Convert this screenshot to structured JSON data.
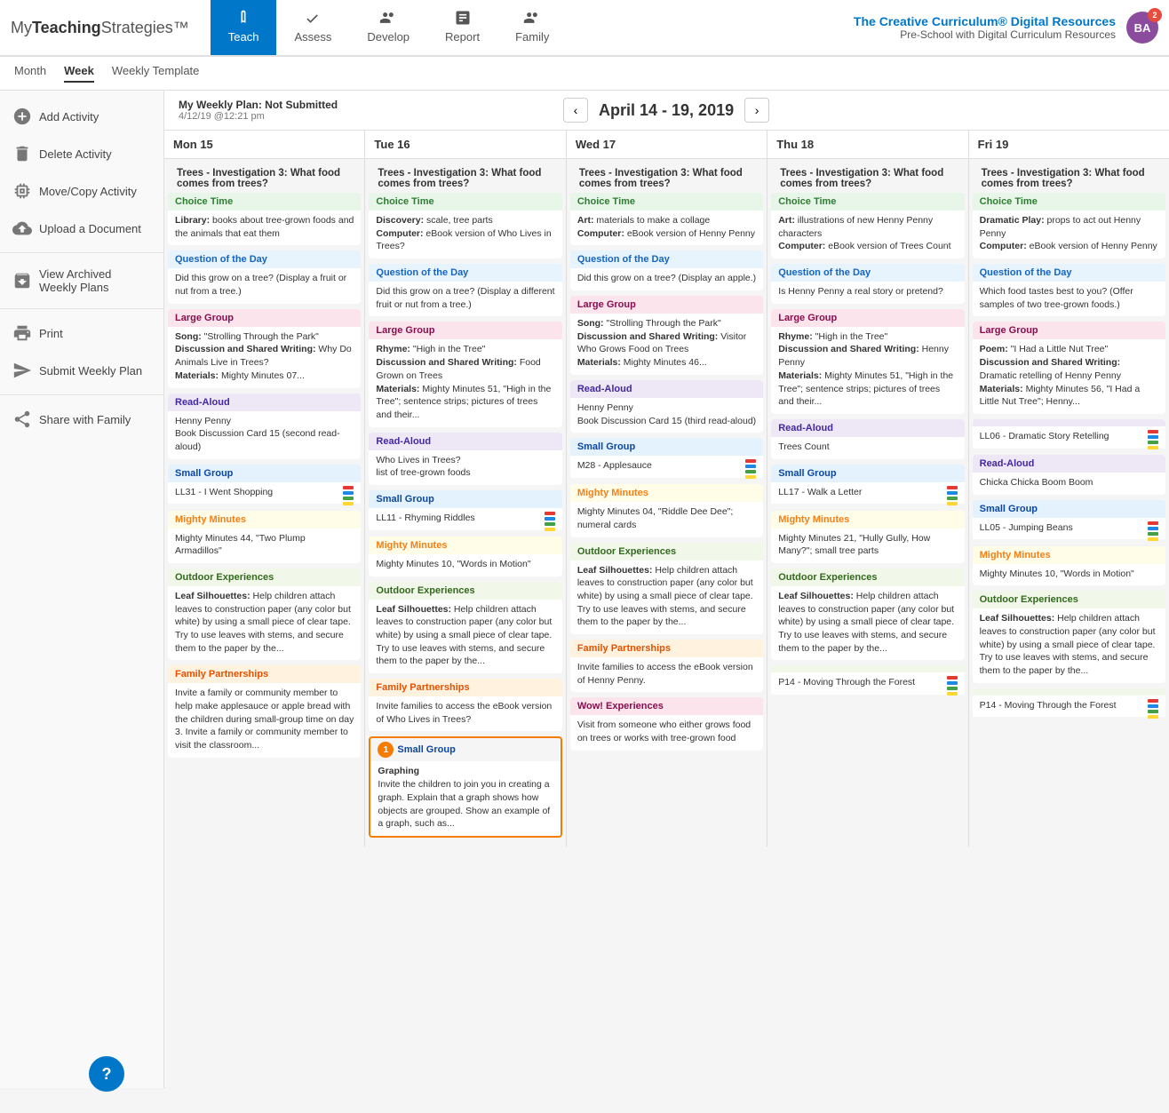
{
  "app": {
    "logo_my": "My",
    "logo_teaching": "Teaching",
    "logo_strategies": "Strategies™",
    "brand": "The Creative Curriculum® Digital Resources",
    "sub": "Pre-School with Digital Curriculum Resources",
    "avatar_initials": "BA",
    "avatar_badge": "2"
  },
  "nav": {
    "tabs": [
      {
        "label": "Teach",
        "icon": "book",
        "active": true
      },
      {
        "label": "Assess",
        "icon": "check"
      },
      {
        "label": "Develop",
        "icon": "bar"
      },
      {
        "label": "Report",
        "icon": "chart"
      },
      {
        "label": "Family",
        "icon": "family"
      }
    ]
  },
  "subnav": {
    "items": [
      "Month",
      "Week",
      "Weekly Template"
    ],
    "active": "Week"
  },
  "sidebar": {
    "items": [
      {
        "label": "Add Activity",
        "icon": "add"
      },
      {
        "label": "Delete Activity",
        "icon": "delete"
      },
      {
        "label": "Move/Copy Activity",
        "icon": "move"
      },
      {
        "label": "Upload a Document",
        "icon": "upload"
      },
      {
        "label": "View Archived Weekly Plans",
        "icon": "archive"
      },
      {
        "label": "Print",
        "icon": "print"
      },
      {
        "label": "Submit Weekly Plan",
        "icon": "submit"
      },
      {
        "label": "Share with Family",
        "icon": "share"
      }
    ]
  },
  "calendar": {
    "meta": "My Weekly Plan: Not Submitted",
    "meta_date": "4/12/19 @12:21 pm",
    "title": "April 14 - 19, 2019",
    "days": [
      {
        "label": "Mon 15",
        "unit": "Trees - Investigation 3: What food comes from trees?",
        "sections": [
          {
            "type": "choice-time",
            "title": "Choice Time",
            "body": "<b>Library:</b> books about tree-grown foods and the animals that eat them"
          },
          {
            "type": "question-day",
            "title": "Question of the Day",
            "body": "Did this grow on a tree? (Display a fruit or nut from a tree.)"
          },
          {
            "type": "large-group",
            "title": "Large Group",
            "body": "<b>Song:</b> \"Strolling Through the Park\"<br><b>Discussion and Shared Writing:</b> Why Do Animals Live in Trees?<br><b>Materials:</b> Mighty Minutes 07..."
          },
          {
            "type": "read-aloud",
            "title": "Read-Aloud",
            "body": "Henny Penny<br>Book Discussion Card 15 (second read-aloud)"
          },
          {
            "type": "small-group",
            "title": "Small Group",
            "body": "LL31 - I Went Shopping",
            "has_icon": true
          },
          {
            "type": "mighty-minutes",
            "title": "Mighty Minutes",
            "body": "Mighty Minutes 44, \"Two Plump Armadillos\""
          },
          {
            "type": "outdoor",
            "title": "Outdoor Experiences",
            "body": "<b>Leaf Silhouettes:</b> Help children attach leaves to construction paper (any color but white) by using a small piece of clear tape. Try to use leaves with stems, and secure them to the paper by the..."
          },
          {
            "type": "family-partnerships",
            "title": "Family Partnerships",
            "body": "Invite a family or community member to help make applesauce or apple bread with the children during small-group time on day 3. Invite a family or community member to visit the classroom..."
          }
        ]
      },
      {
        "label": "Tue 16",
        "unit": "Trees - Investigation 3: What food comes from trees?",
        "sections": [
          {
            "type": "choice-time",
            "title": "Choice Time",
            "body": "<b>Discovery:</b> scale, tree parts<br><b>Computer:</b> eBook version of Who Lives in Trees?"
          },
          {
            "type": "question-day",
            "title": "Question of the Day",
            "body": "Did this grow on a tree? (Display a different fruit or nut from a tree.)"
          },
          {
            "type": "large-group",
            "title": "Large Group",
            "body": "<b>Rhyme:</b> \"High in the Tree\"<br><b>Discussion and Shared Writing:</b> Food Grown on Trees<br><b>Materials:</b> Mighty Minutes 51, \"High in the Tree\"; sentence strips; pictures of trees and their..."
          },
          {
            "type": "read-aloud",
            "title": "Read-Aloud",
            "body": "Who Lives in Trees?<br>list of tree-grown foods"
          },
          {
            "type": "small-group",
            "title": "Small Group",
            "body": "LL11 - Rhyming Riddles",
            "has_icon": true
          },
          {
            "type": "mighty-minutes",
            "title": "Mighty Minutes",
            "body": "Mighty Minutes 10, \"Words in Motion\""
          },
          {
            "type": "outdoor",
            "title": "Outdoor Experiences",
            "body": "<b>Leaf Silhouettes:</b> Help children attach leaves to construction paper (any color but white) by using a small piece of clear tape. Try to use leaves with stems, and secure them to the paper by the..."
          },
          {
            "type": "family-partnerships",
            "title": "Family Partnerships",
            "body": "Invite families to access the eBook version of Who Lives in Trees?"
          },
          {
            "type": "small-group",
            "title": "Small Group",
            "highlighted": true,
            "body": "<b>Graphing</b><br>Invite the children to join you in creating a graph. Explain that a graph shows how objects are grouped. Show an example of a graph, such as..."
          }
        ]
      },
      {
        "label": "Wed 17",
        "unit": "Trees - Investigation 3: What food comes from trees?",
        "sections": [
          {
            "type": "choice-time",
            "title": "Choice Time",
            "body": "<b>Art:</b> materials to make a collage<br><b>Computer:</b> eBook version of Henny Penny"
          },
          {
            "type": "question-day",
            "title": "Question of the Day",
            "body": "Did this grow on a tree? (Display an apple.)"
          },
          {
            "type": "large-group",
            "title": "Large Group",
            "body": "<b>Song:</b> \"Strolling Through the Park\"<br><b>Discussion and Shared Writing:</b> Visitor Who Grows Food on Trees<br><b>Materials:</b> Mighty Minutes 46..."
          },
          {
            "type": "read-aloud",
            "title": "Read-Aloud",
            "body": "Henny Penny<br>Book Discussion Card 15 (third read-aloud)"
          },
          {
            "type": "small-group",
            "title": "Small Group",
            "body": "M28 - Applesauce",
            "has_icon": true
          },
          {
            "type": "mighty-minutes",
            "title": "Mighty Minutes",
            "body": "Mighty Minutes 04, \"Riddle Dee Dee\"; numeral cards"
          },
          {
            "type": "outdoor",
            "title": "Outdoor Experiences",
            "body": "<b>Leaf Silhouettes:</b> Help children attach leaves to construction paper (any color but white) by using a small piece of clear tape. Try to use leaves with stems, and secure them to the paper by the..."
          },
          {
            "type": "family-partnerships",
            "title": "Family Partnerships",
            "body": "Invite families to access the eBook version of Henny Penny."
          },
          {
            "type": "wow-experiences",
            "title": "Wow! Experiences",
            "body": "Visit from someone who either grows food on trees or works with tree-grown food"
          }
        ]
      },
      {
        "label": "Thu 18",
        "unit": "Trees - Investigation 3: What food comes from trees?",
        "sections": [
          {
            "type": "choice-time",
            "title": "Choice Time",
            "body": "<b>Art:</b> illustrations of new Henny Penny characters<br><b>Computer:</b> eBook version of Trees Count"
          },
          {
            "type": "question-day",
            "title": "Question of the Day",
            "body": "Is Henny Penny a real story or pretend?"
          },
          {
            "type": "large-group",
            "title": "Large Group",
            "body": "<b>Rhyme:</b> \"High in the Tree\"<br><b>Discussion and Shared Writing:</b> Henny Penny<br><b>Materials:</b> Mighty Minutes 51, \"High in the Tree\"; sentence strips; pictures of trees and their..."
          },
          {
            "type": "read-aloud",
            "title": "Read-Aloud",
            "body": "Trees Count"
          },
          {
            "type": "small-group",
            "title": "Small Group",
            "body": "LL17 - Walk a Letter",
            "has_icon": true
          },
          {
            "type": "mighty-minutes",
            "title": "Mighty Minutes",
            "body": "Mighty Minutes 21, \"Hully Gully, How Many?\"; small tree parts"
          },
          {
            "type": "outdoor",
            "title": "Outdoor Experiences",
            "body": "<b>Leaf Silhouettes:</b> Help children attach leaves to construction paper (any color but white) by using a small piece of clear tape. Try to use leaves with stems, and secure them to the paper by the..."
          },
          {
            "type": "outdoor",
            "title": "",
            "body": "P14 - Moving Through the Forest",
            "has_icon": true
          }
        ]
      },
      {
        "label": "Fri 19",
        "unit": "Trees - Investigation 3: What food comes from trees?",
        "sections": [
          {
            "type": "choice-time",
            "title": "Choice Time",
            "body": "<b>Dramatic Play:</b> props to act out Henny Penny<br><b>Computer:</b> eBook version of Henny Penny"
          },
          {
            "type": "question-day",
            "title": "Question of the Day",
            "body": "Which food tastes best to you? (Offer samples of two tree-grown foods.)"
          },
          {
            "type": "large-group",
            "title": "Large Group",
            "body": "<b>Poem:</b> \"I Had a Little Nut Tree\"<br><b>Discussion and Shared Writing:</b> Dramatic retelling of Henny Penny<br><b>Materials:</b> Mighty Minutes 56, \"I Had a Little Nut Tree\"; Henny..."
          },
          {
            "type": "read-aloud",
            "title": "",
            "body": "LL06 - Dramatic Story Retelling",
            "has_icon": true
          },
          {
            "type": "read-aloud",
            "title": "Read-Aloud",
            "body": "Chicka Chicka Boom Boom"
          },
          {
            "type": "small-group",
            "title": "Small Group",
            "body": "LL05 - Jumping Beans",
            "has_icon": true
          },
          {
            "type": "mighty-minutes",
            "title": "Mighty Minutes",
            "body": "Mighty Minutes 10, \"Words in Motion\""
          },
          {
            "type": "outdoor",
            "title": "Outdoor Experiences",
            "body": "<b>Leaf Silhouettes:</b> Help children attach leaves to construction paper (any color but white) by using a small piece of clear tape. Try to use leaves with stems, and secure them to the paper by the..."
          },
          {
            "type": "outdoor",
            "title": "",
            "body": "P14 - Moving Through the Forest",
            "has_icon": true
          }
        ]
      }
    ]
  },
  "help": {
    "label": "?"
  }
}
